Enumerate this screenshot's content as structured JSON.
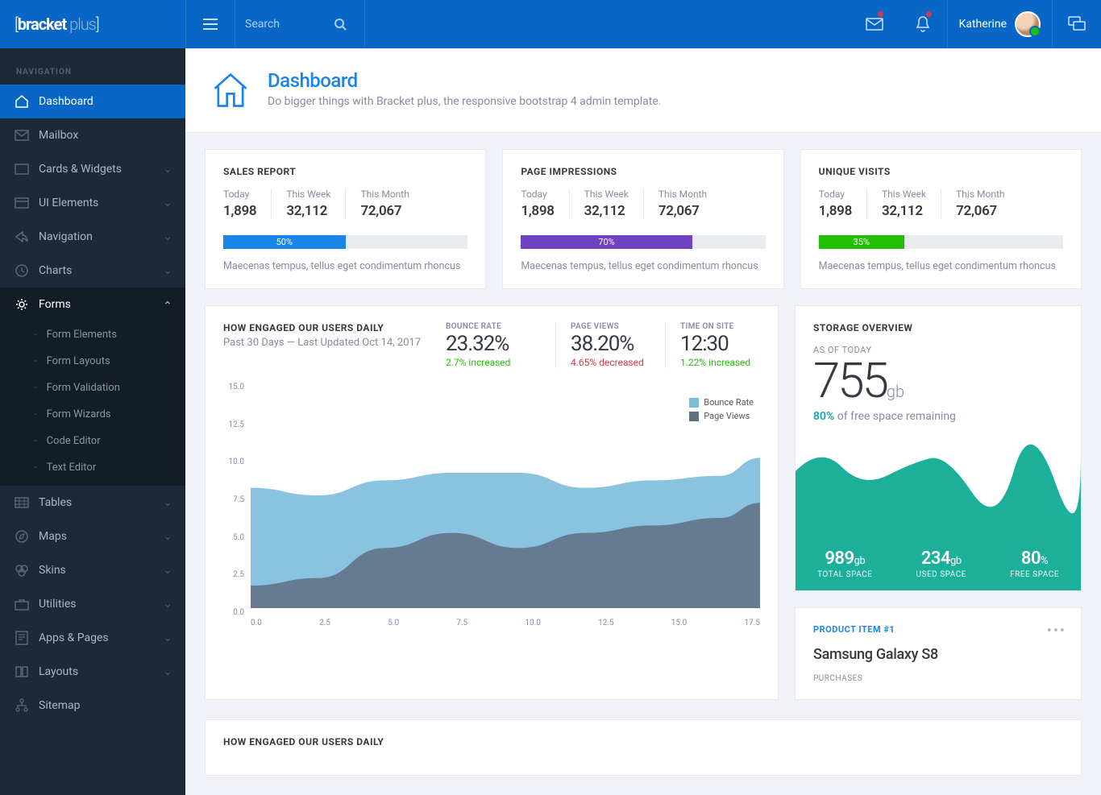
{
  "brand": {
    "bracket_open": "[",
    "name": "bracket",
    "plus": "plus",
    "bracket_close": "]"
  },
  "search": {
    "placeholder": "Search"
  },
  "user": {
    "name": "Katherine"
  },
  "nav": {
    "label": "Navigation",
    "items": [
      {
        "label": "Dashboard"
      },
      {
        "label": "Mailbox"
      },
      {
        "label": "Cards & Widgets"
      },
      {
        "label": "UI Elements"
      },
      {
        "label": "Navigation"
      },
      {
        "label": "Charts"
      },
      {
        "label": "Forms",
        "sub": [
          {
            "label": "Form Elements"
          },
          {
            "label": "Form Layouts"
          },
          {
            "label": "Form Validation"
          },
          {
            "label": "Form Wizards"
          },
          {
            "label": "Code Editor"
          },
          {
            "label": "Text Editor"
          }
        ]
      },
      {
        "label": "Tables"
      },
      {
        "label": "Maps"
      },
      {
        "label": "Skins"
      },
      {
        "label": "Utilities"
      },
      {
        "label": "Apps & Pages"
      },
      {
        "label": "Layouts"
      },
      {
        "label": "Sitemap"
      }
    ]
  },
  "page": {
    "title": "Dashboard",
    "subtitle": "Do bigger things with Bracket plus, the responsive bootstrap 4 admin template."
  },
  "topcards": [
    {
      "title": "SALES REPORT",
      "today_label": "Today",
      "today": "1,898",
      "week_label": "This Week",
      "week": "32,112",
      "month_label": "This Month",
      "month": "72,067",
      "progress": "50%",
      "color": "#1b84e7",
      "note": "Maecenas tempus, tellus eget condimentum rhoncus"
    },
    {
      "title": "PAGE IMPRESSIONS",
      "today_label": "Today",
      "today": "1,898",
      "week_label": "This Week",
      "week": "32,112",
      "month_label": "This Month",
      "month": "72,067",
      "progress": "70%",
      "color": "#6f42c1",
      "note": "Maecenas tempus, tellus eget condimentum rhoncus"
    },
    {
      "title": "UNIQUE VISITS",
      "today_label": "Today",
      "today": "1,898",
      "week_label": "This Week",
      "week": "32,112",
      "month_label": "This Month",
      "month": "72,067",
      "progress": "35%",
      "color": "#23bf08",
      "note": "Maecenas tempus, tellus eget condimentum rhoncus"
    }
  ],
  "engage": {
    "title": "HOW ENGAGED OUR USERS DAILY",
    "subtitle": "Past 30 Days — Last Updated Oct 14, 2017",
    "metrics": [
      {
        "label": "BOUNCE RATE",
        "value": "23.32%",
        "change": "2.7% increased",
        "class": "green"
      },
      {
        "label": "PAGE VIEWS",
        "value": "38.20%",
        "change": "4.65% decreased",
        "class": "red"
      },
      {
        "label": "TIME ON SITE",
        "value": "12:30",
        "change": "1.22% increased",
        "class": "green"
      }
    ],
    "legend": [
      {
        "label": "Bounce Rate",
        "color": "#7cbddb"
      },
      {
        "label": "Page Views",
        "color": "#5f6f84"
      }
    ],
    "yticks": [
      "15.0",
      "12.5",
      "10.0",
      "7.5",
      "5.0",
      "2.5",
      "0.0"
    ],
    "xticks": [
      "0.0",
      "2.5",
      "5.0",
      "7.5",
      "10.0",
      "12.5",
      "15.0",
      "17.5"
    ]
  },
  "storage": {
    "title": "STORAGE OVERVIEW",
    "asof": "AS OF TODAY",
    "value": "755",
    "unit": "gb",
    "pct": "80%",
    "pct_label": " of free space remaining",
    "stats": [
      {
        "value": "989",
        "unit": "gb",
        "label": "TOTAL SPACE"
      },
      {
        "value": "234",
        "unit": "gb",
        "label": "USED SPACE"
      },
      {
        "value": "80",
        "unit": "%",
        "label": "FREE SPACE"
      }
    ]
  },
  "product": {
    "label": "PRODUCT ITEM #1",
    "name": "Samsung Galaxy S8",
    "purchases_label": "PURCHASES"
  },
  "engage2": {
    "title": "HOW ENGAGED OUR USERS DAILY"
  },
  "chart_data": {
    "type": "area",
    "x": [
      0,
      2.5,
      5,
      7.5,
      10,
      12.5,
      15,
      17.5,
      19
    ],
    "series": [
      {
        "name": "Bounce Rate",
        "values": [
          8.0,
          7.5,
          8.5,
          9.0,
          9.0,
          8.0,
          8.5,
          8.8,
          10.0
        ]
      },
      {
        "name": "Page Views",
        "values": [
          1.5,
          2.0,
          4.0,
          5.0,
          4.0,
          5.0,
          5.5,
          6.0,
          7.0
        ]
      }
    ],
    "ylim": [
      0,
      15
    ],
    "xlim": [
      0,
      19
    ]
  }
}
